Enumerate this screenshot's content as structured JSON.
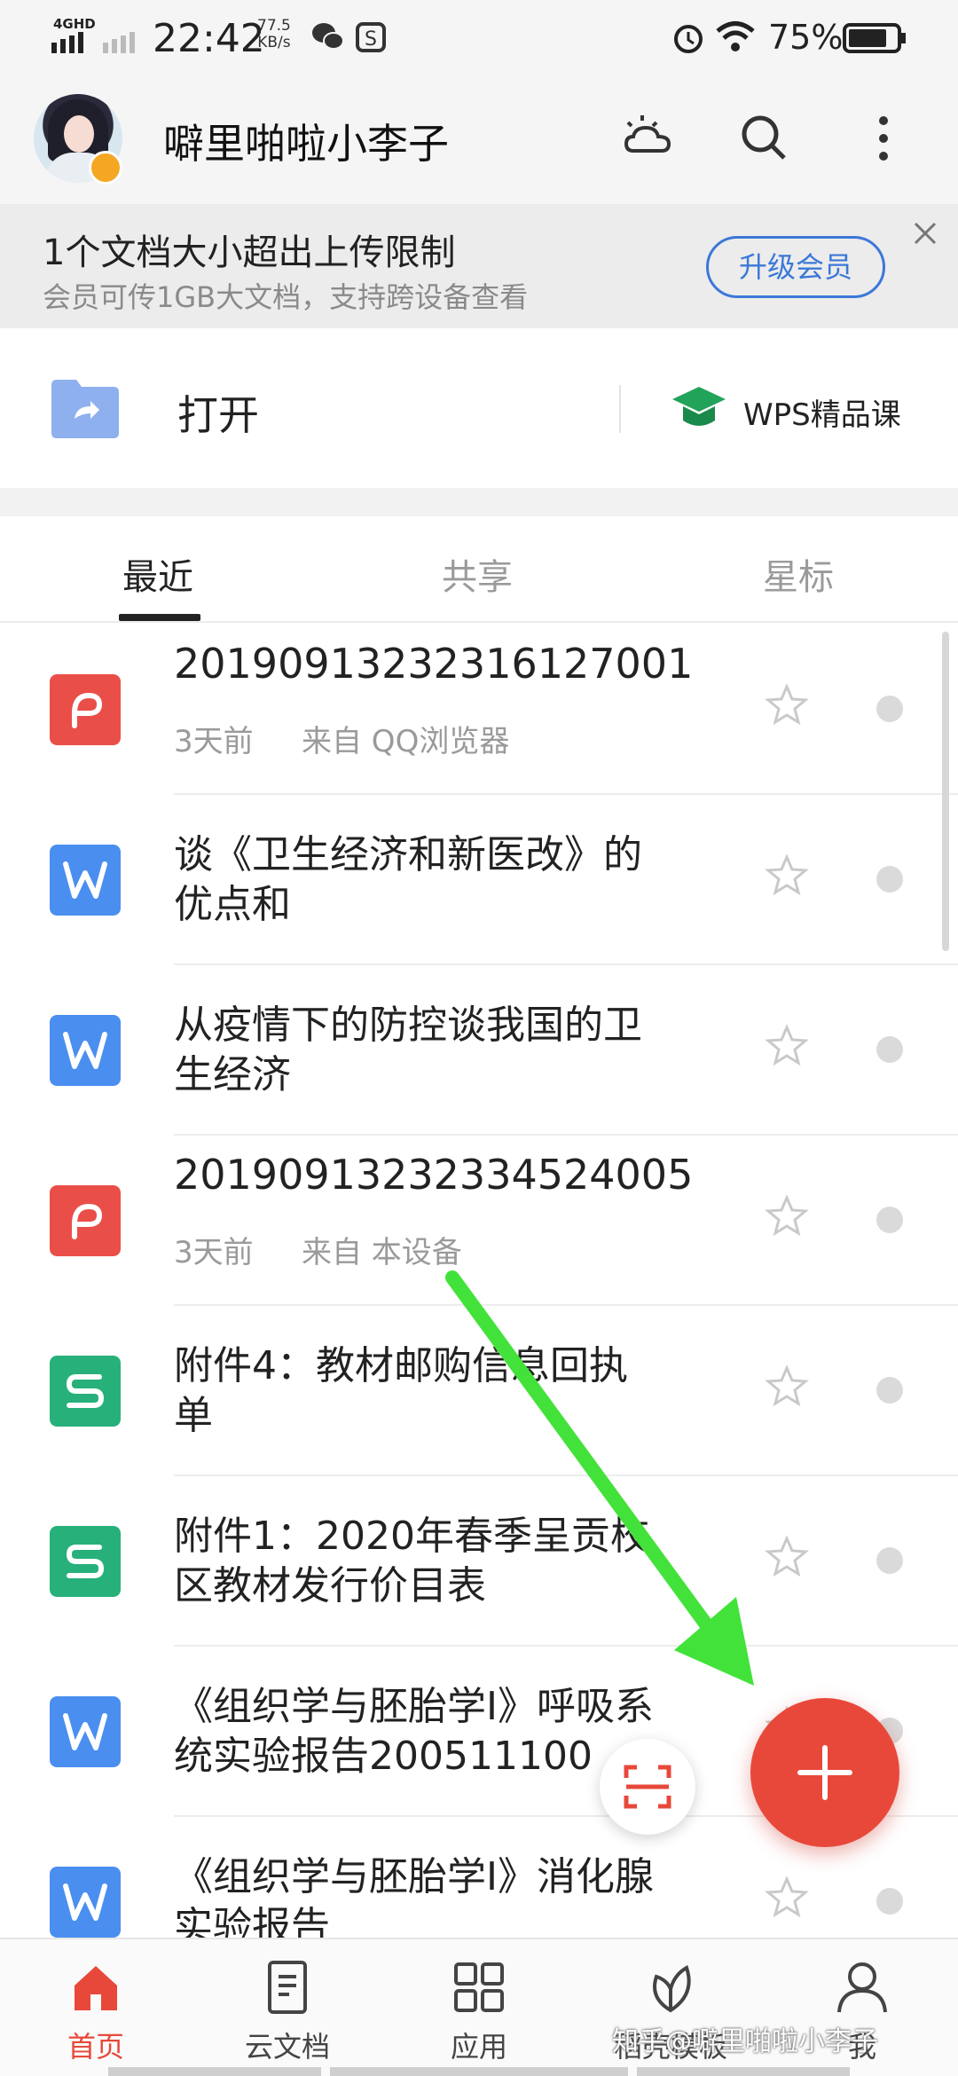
{
  "status_bar": {
    "network": "4GHD",
    "time": "22:42",
    "speed_value": "77.5",
    "speed_unit": "KB/s",
    "battery": "75%"
  },
  "header": {
    "username": "噼里啪啦小李子",
    "icons": [
      "weather-icon",
      "search-icon",
      "more-icon"
    ]
  },
  "banner": {
    "title": "1个文档大小超出上传限制",
    "subtitle": "会员可传1GB大文档，支持跨设备查看",
    "button": "升级会员"
  },
  "quick": {
    "open_label": "打开",
    "course_label": "WPS精品课"
  },
  "tabs": [
    {
      "label": "最近",
      "active": true
    },
    {
      "label": "共享",
      "active": false
    },
    {
      "label": "星标",
      "active": false
    }
  ],
  "files": [
    {
      "type": "pdf",
      "title": "20190913232316127001",
      "meta_time": "3天前",
      "meta_source": "来自 QQ浏览器"
    },
    {
      "type": "word",
      "title_line1": "谈《卫生经济和新医改》的",
      "title_line2": "优点和"
    },
    {
      "type": "word",
      "title_line1": "从疫情下的防控谈我国的卫",
      "title_line2": "生经济"
    },
    {
      "type": "pdf",
      "title": "20190913232334524005",
      "meta_time": "3天前",
      "meta_source": "来自 本设备"
    },
    {
      "type": "sheet",
      "title_line1": "附件4：教材邮购信息回执",
      "title_line2": "单"
    },
    {
      "type": "sheet",
      "title_line1": "附件1：2020年春季呈贡校",
      "title_line2": "区教材发行价目表"
    },
    {
      "type": "word",
      "title_line1": "《组织学与胚胎学I》呼吸系",
      "title_line2": "统实验报告200511100"
    },
    {
      "type": "word",
      "title_line1": "《组织学与胚胎学I》消化腺",
      "title_line2": "实验报告"
    }
  ],
  "colors": {
    "pdf": "#e94f48",
    "word": "#4a8ef0",
    "sheet": "#27b07a",
    "accent": "#e8483a",
    "upgrade": "#3b78d8",
    "arrow": "#43e23a"
  },
  "nav": [
    {
      "label": "首页",
      "icon": "home-icon",
      "active": true
    },
    {
      "label": "云文档",
      "icon": "cloud-doc-icon",
      "active": false
    },
    {
      "label": "应用",
      "icon": "apps-icon",
      "active": false
    },
    {
      "label": "稻壳模板",
      "icon": "leaf-template-icon",
      "active": false
    },
    {
      "label": "我",
      "icon": "profile-icon",
      "active": false
    }
  ],
  "watermark": "知乎@噼里啪啦小李子"
}
